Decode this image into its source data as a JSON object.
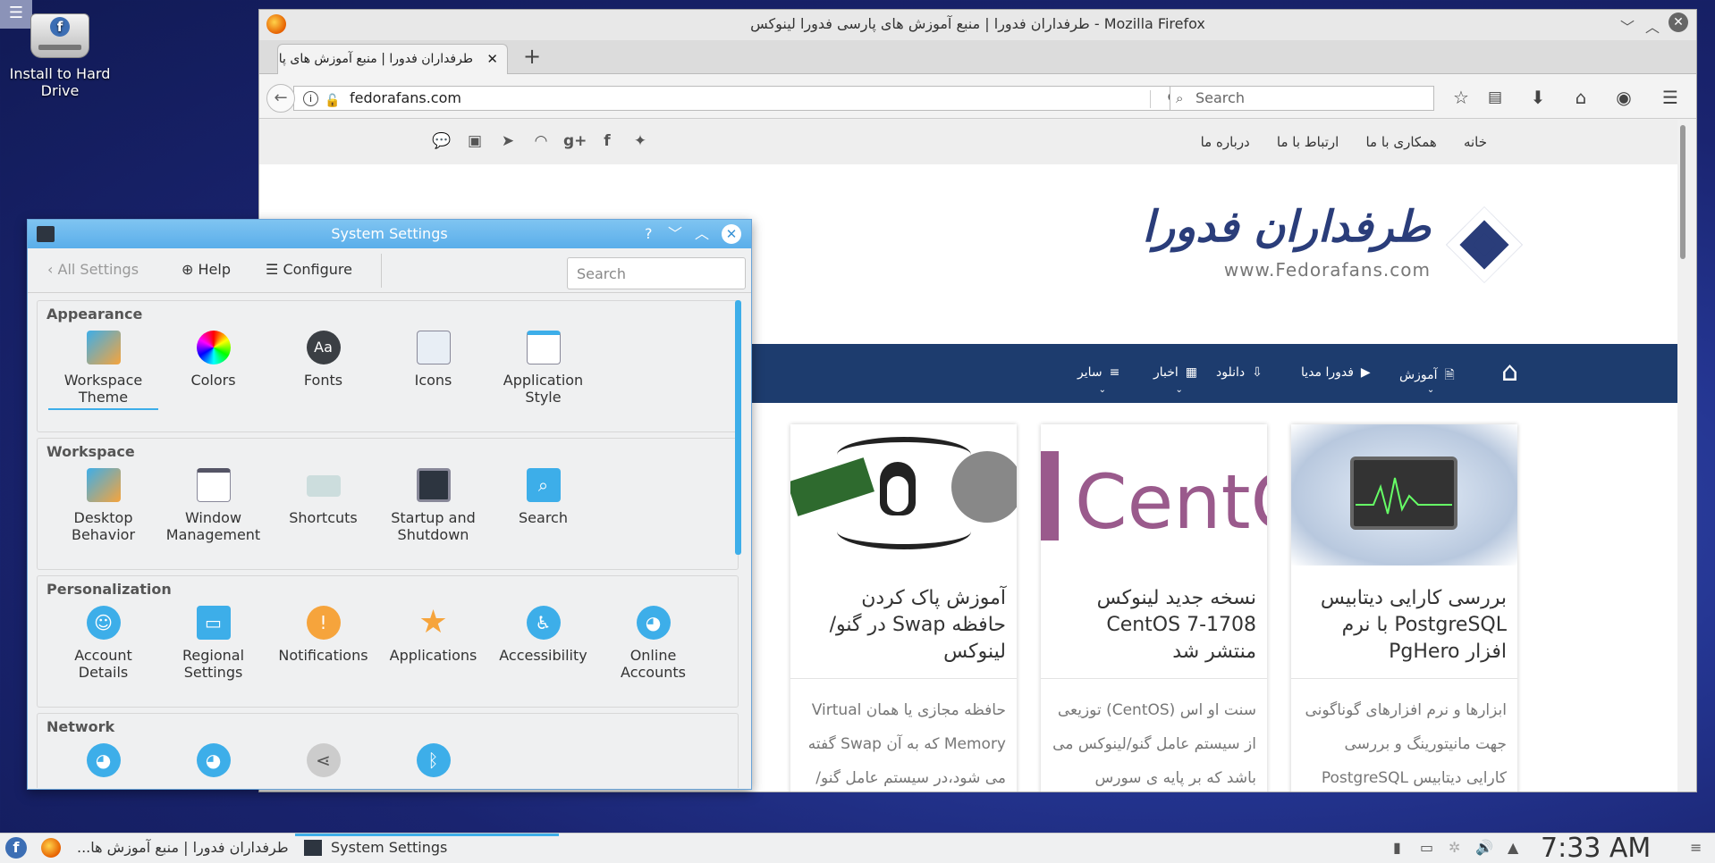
{
  "desktop": {
    "icon_label": "Install to Hard Drive",
    "corner_menu": "☰"
  },
  "firefox": {
    "title": "طرفداران فدورا | منبع آموزش های پارسی فدورا لینوکس - Mozilla Firefox",
    "tab_title": "طرفداران فدورا | منبع آموزش های پارسی فدورا لینوکس",
    "url": "fedorafans.com",
    "search_placeholder": "Search",
    "site": {
      "top_links": [
        "خانه",
        "همکاری با ما",
        "ارتباط با ما",
        "درباره ما"
      ],
      "brand_name": "طرفداران فدورا",
      "brand_url": "www.Fedorafans.com",
      "menu": [
        "آموزش",
        "فدورا مدیا",
        "دانلود",
        "اخبار",
        "سایر"
      ],
      "cards": [
        {
          "title": "بررسی کارایی دیتابیس PostgreSQL با نرم افزار PgHero",
          "text": "ابزارها و نرم افزارهای گوناگونی جهت مانیتورینگ و بررسی کارایی دیتابیس PostgreSQL"
        },
        {
          "title": "نسخه جدید لینوکس CentOS 7-1708 منتشر شد",
          "img_text": "CentOS",
          "text": "سنت او اس (CentOS) توزیعی از سیستم عامل گنو/لینوکس می باشد که بر پایه ی سورس"
        },
        {
          "title": "آموزش پاک کردن حافظه Swap در گنو/لینوکس",
          "text": "حافظه مجازی یا همان Virtual Memory که به آن Swap گفته می شود،در سیستم عامل گنو/لینوکس زمانی مورد"
        }
      ]
    }
  },
  "settings": {
    "title": "System Settings",
    "toolbar": {
      "back": "All Settings",
      "help": "Help",
      "configure": "Configure"
    },
    "search_placeholder": "Search",
    "sections": [
      {
        "name": "Appearance",
        "items": [
          "Workspace Theme",
          "Colors",
          "Fonts",
          "Icons",
          "Application Style"
        ]
      },
      {
        "name": "Workspace",
        "items": [
          "Desktop Behavior",
          "Window Management",
          "Shortcuts",
          "Startup and Shutdown",
          "Search"
        ]
      },
      {
        "name": "Personalization",
        "items": [
          "Account Details",
          "Regional Settings",
          "Notifications",
          "Applications",
          "Accessibility",
          "Online Accounts"
        ]
      },
      {
        "name": "Network"
      }
    ]
  },
  "taskbar": {
    "firefox_task": "طرفداران فدورا | منبع آموزش ها...",
    "settings_task": "System Settings",
    "clock": "7:33 AM"
  },
  "colors": {
    "accent": "#3daee9",
    "site_nav": "#1d3c6e",
    "brand": "#2a3d7a"
  }
}
